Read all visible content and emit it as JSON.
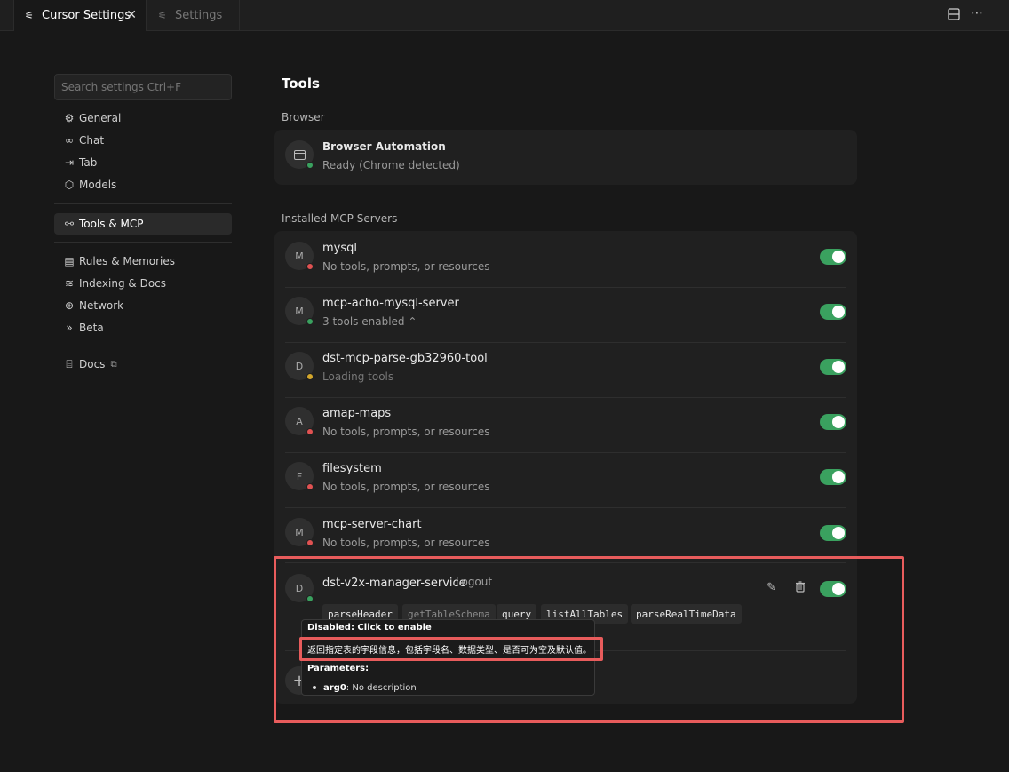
{
  "tabs": [
    {
      "label": "Cursor Settings",
      "active": true
    },
    {
      "label": "Settings",
      "active": false
    }
  ],
  "search": {
    "placeholder": "Search settings Ctrl+F"
  },
  "nav": {
    "group1": [
      {
        "label": "General",
        "icon": "gear-icon"
      },
      {
        "label": "Chat",
        "icon": "infinity-icon"
      },
      {
        "label": "Tab",
        "icon": "arrow-tab-icon"
      },
      {
        "label": "Models",
        "icon": "cube-icon"
      }
    ],
    "tools": {
      "label": "Tools & MCP",
      "icon": "tools-icon"
    },
    "group2": [
      {
        "label": "Rules & Memories",
        "icon": "clipboard-icon"
      },
      {
        "label": "Indexing & Docs",
        "icon": "database-icon"
      },
      {
        "label": "Network",
        "icon": "globe-icon"
      },
      {
        "label": "Beta",
        "icon": "double-chevron-icon"
      }
    ],
    "docs": {
      "label": "Docs",
      "icon": "book-icon"
    }
  },
  "main": {
    "title": "Tools",
    "browser_label": "Browser",
    "browser": {
      "title": "Browser Automation",
      "status": "Ready (Chrome detected)",
      "dot": "#3aa15f"
    },
    "mcp_label": "Installed MCP Servers",
    "servers": [
      {
        "initial": "M",
        "name": "mysql",
        "status": "No tools, prompts, or resources",
        "dot": "#e05252"
      },
      {
        "initial": "M",
        "name": "mcp-acho-mysql-server",
        "status": "3 tools enabled ⌃",
        "dot": "#3aa15f"
      },
      {
        "initial": "D",
        "name": "dst-mcp-parse-gb32960-tool",
        "status": "Loading tools",
        "dot": "#d4a72c"
      },
      {
        "initial": "A",
        "name": "amap-maps",
        "status": "No tools, prompts, or resources",
        "dot": "#e05252"
      },
      {
        "initial": "F",
        "name": "filesystem",
        "status": "No tools, prompts, or resources",
        "dot": "#e05252"
      },
      {
        "initial": "M",
        "name": "mcp-server-chart",
        "status": "No tools, prompts, or resources",
        "dot": "#e05252"
      }
    ],
    "service": {
      "initial": "D",
      "name": "dst-v2x-manager-service",
      "logout": "Logout",
      "dot": "#3aa15f",
      "chips": [
        "parseHeader",
        "getTableSchema",
        "query",
        "listAllTables",
        "parseRealTimeData"
      ]
    },
    "tooltip": {
      "title": "Disabled: Click to enable",
      "desc": "返回指定表的字段信息，包括字段名、数据类型、是否可为空及默认值。",
      "params": "Parameters:",
      "arg_name": "arg0",
      "arg_desc": ": No description"
    }
  }
}
